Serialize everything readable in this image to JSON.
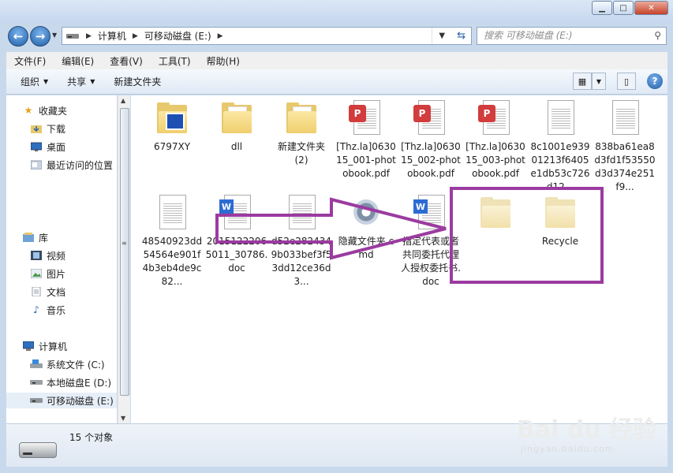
{
  "address": {
    "crumbs": [
      "计算机",
      "可移动磁盘 (E:)"
    ],
    "search_placeholder": "搜索 可移动磁盘 (E:)"
  },
  "menu": [
    "文件(F)",
    "编辑(E)",
    "查看(V)",
    "工具(T)",
    "帮助(H)"
  ],
  "toolbar": {
    "organize": "组织",
    "share": "共享",
    "new_folder": "新建文件夹"
  },
  "nav": {
    "favorites": "收藏夹",
    "downloads": "下载",
    "desktop": "桌面",
    "recent": "最近访问的位置",
    "library": "库",
    "videos": "视频",
    "pictures": "图片",
    "documents": "文档",
    "music": "音乐",
    "computer": "计算机",
    "drive_c": "系统文件 (C:)",
    "drive_d": "本地磁盘E (D:)",
    "drive_e": "可移动磁盘 (E:)"
  },
  "files": [
    {
      "name": "6797XY",
      "icon": "video-folder-icon"
    },
    {
      "name": "dll",
      "icon": "folder-icon"
    },
    {
      "name": "新建文件夹 (2)",
      "icon": "folder-icon"
    },
    {
      "name": "[Thz.la]063015_001-photobook.pdf",
      "icon": "pdf-icon"
    },
    {
      "name": "[Thz.la]063015_002-photobook.pdf",
      "icon": "pdf-icon"
    },
    {
      "name": "[Thz.la]063015_003-photobook.pdf",
      "icon": "pdf-icon"
    },
    {
      "name": "8c1001e93901213f6405e1db53c726d12...",
      "icon": "image-doc-icon"
    },
    {
      "name": "838ba61ea8d3fd1f53550d3d374e251f9...",
      "icon": "image-doc-icon"
    },
    {
      "name": "48540923dd54564e901f4b3eb4de9c82...",
      "icon": "image-doc-icon"
    },
    {
      "name": "20151222065011_30786.doc",
      "icon": "word-doc-icon"
    },
    {
      "name": "d52e2824349b033bef3f53dd12ce36d3...",
      "icon": "image-doc-icon"
    },
    {
      "name": "隐藏文件夹.cmd",
      "icon": "cmd-gear-icon"
    },
    {
      "name": "指定代表或者共同委托代理人授权委托书.doc",
      "icon": "word-doc-icon"
    },
    {
      "name": "",
      "icon": "hidden-folder-icon"
    },
    {
      "name": "Recycle",
      "icon": "hidden-folder-icon"
    }
  ],
  "status": {
    "count": "15 个对象"
  },
  "watermark": {
    "brand": "Bai du 经验",
    "url": "jingyan.baidu.com"
  },
  "colors": {
    "annotation": "#9b3ba0"
  }
}
